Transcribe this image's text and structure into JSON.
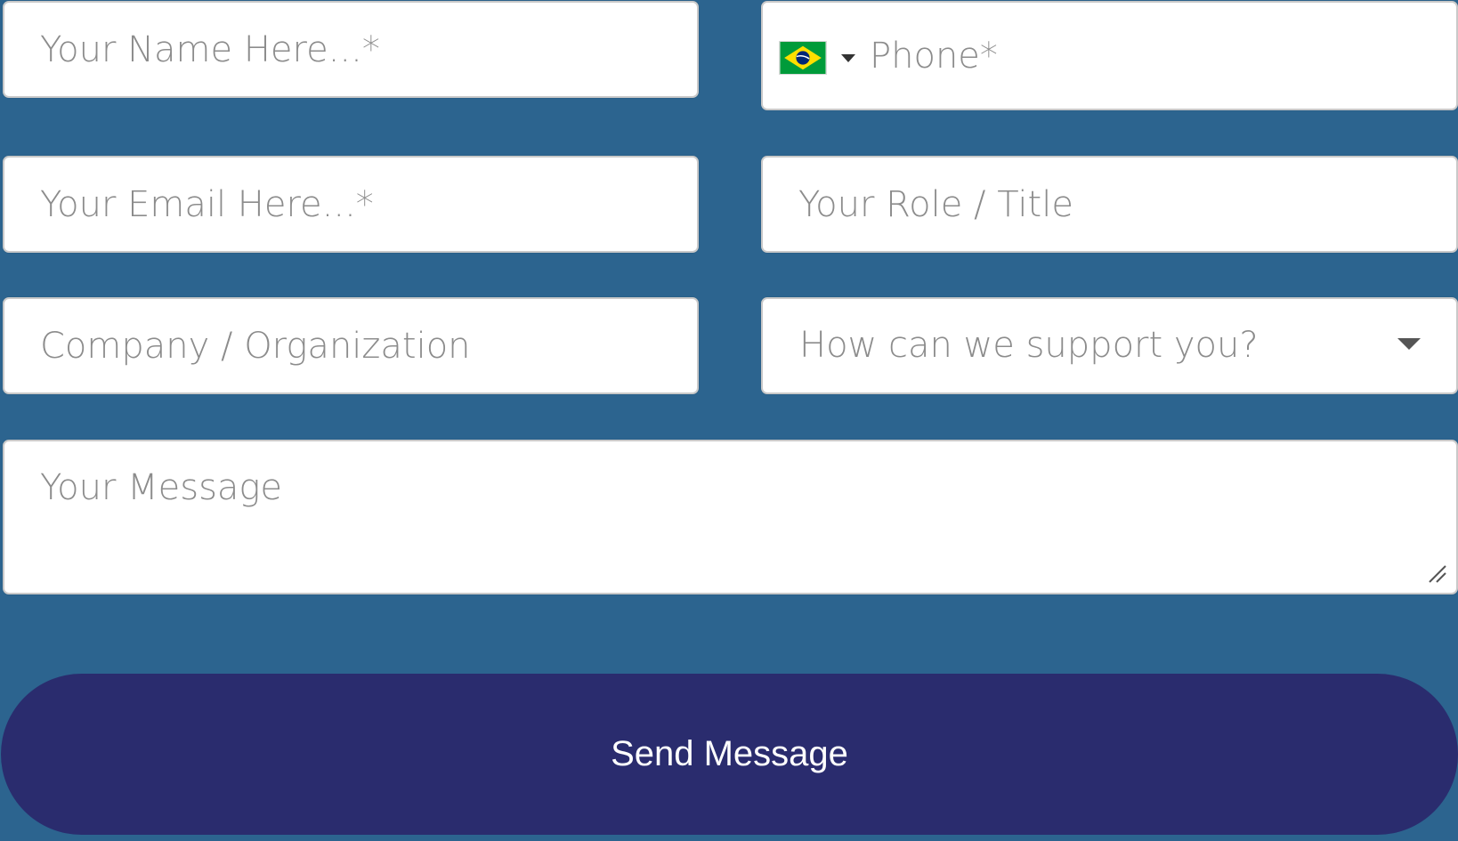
{
  "form": {
    "name": {
      "placeholder": "Your Name Here...*"
    },
    "phone": {
      "placeholder": "Phone*",
      "country_flag": "brazil-flag",
      "flag_colors": {
        "green": "#009b3a",
        "yellow": "#fedf00",
        "blue": "#002776"
      }
    },
    "email": {
      "placeholder": "Your Email Here...*"
    },
    "role": {
      "placeholder": "Your Role / Title"
    },
    "company": {
      "placeholder": "Company / Organization"
    },
    "support": {
      "selected": "How can we support you?"
    },
    "message": {
      "placeholder": "Your Message"
    },
    "submit_label": "Send Message"
  },
  "colors": {
    "page_background": "#2c648f",
    "field_background": "#ffffff",
    "button_background": "#2a2c6e",
    "button_text": "#ffffff",
    "placeholder_text": "#8c8c8c"
  }
}
